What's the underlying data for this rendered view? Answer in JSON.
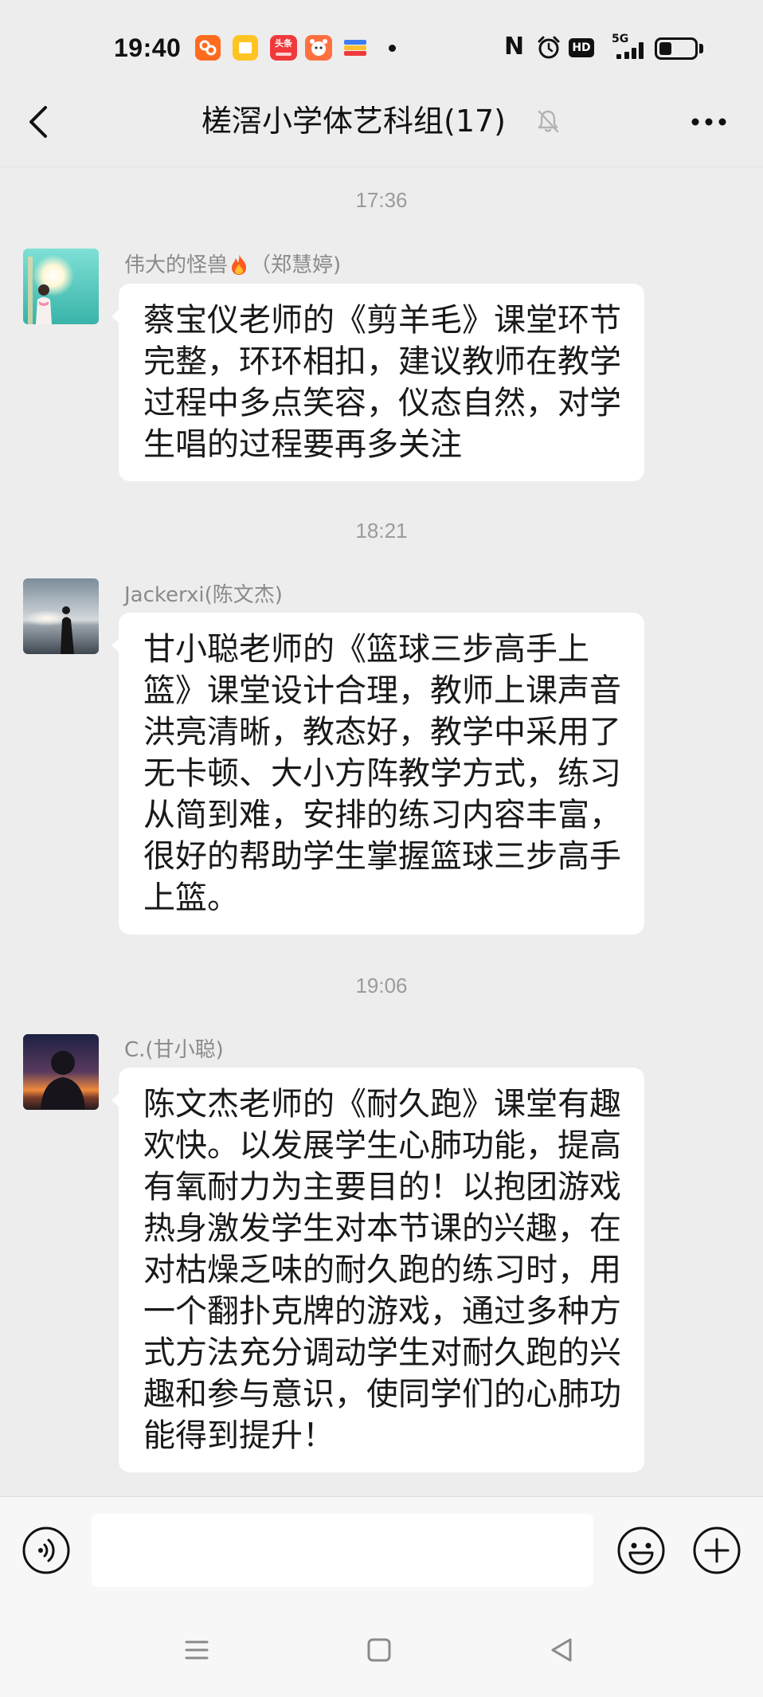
{
  "colors": {
    "background": "#ededed",
    "bubble": "#ffffff",
    "message_text": "#191919",
    "meta_text": "#9b9b9b",
    "bottom_bar": "#f7f7f7"
  },
  "status_bar": {
    "time": "19:40",
    "app_icons": [
      {
        "icon": "orange-app-icon",
        "color": "#ff6b1f"
      },
      {
        "icon": "notes-app-icon",
        "color": "#ffc423"
      },
      {
        "icon": "toutiao-app-icon",
        "color": "#f0393c",
        "label": "头条"
      },
      {
        "icon": "cartoon-app-icon",
        "color": "#ff7040"
      },
      {
        "icon": "stripes-app-icon",
        "color": "#3d7cf2"
      }
    ],
    "overflow_indicator": "dot-icon",
    "nfc_label": "N",
    "alarm_icon": "alarm-icon",
    "hd_label": "HD",
    "network_label": "5G",
    "signal_icon": "signal-bars-icon",
    "battery_icon": "battery-icon",
    "battery_level": 0.35
  },
  "header": {
    "back_icon": "back-arrow-icon",
    "title": "槎滘小学体艺科组(17)",
    "mute_icon": "bell-mute-icon",
    "more_icon": "more-dots-icon"
  },
  "messages": [
    {
      "time": "17:36",
      "avatar": "avatar-teal-photo",
      "sender": "伟大的怪兽",
      "sender_icon": "fire-icon",
      "sender_remark": "（郑慧婷)",
      "lines": [
        "蔡宝仪老师的《剪羊毛》课堂环节",
        "完整，环环相扣，建议教师在教学",
        "过程中多点笑容，仪态自然，对学",
        "生唱的过程要再多关注"
      ]
    },
    {
      "time": "18:21",
      "avatar": "avatar-seaside-photo",
      "sender": "Jackerxi(陈文杰)",
      "lines": [
        "甘小聪老师的《篮球三步高手上",
        "篮》课堂设计合理，教师上课声音",
        "洪亮清晰，教态好，教学中采用了",
        "无卡顿、大小方阵教学方式，练习",
        "从简到难，安排的练习内容丰富，",
        "很好的帮助学生掌握篮球三步高手",
        "上篮。"
      ]
    },
    {
      "time": "19:06",
      "avatar": "avatar-sunset-photo",
      "sender": "C.(甘小聪)",
      "lines": [
        "陈文杰老师的《耐久跑》课堂有趣",
        "欢快。以发展学生心肺功能，提高",
        "有氧耐力为主要目的！以抱团游戏",
        "热身激发学生对本节课的兴趣，在",
        "对枯燥乏味的耐久跑的练习时，用",
        "一个翻扑克牌的游戏，通过多种方",
        "式方法充分调动学生对耐久跑的兴",
        "趣和参与意识，使同学们的心肺功",
        "能得到提升！"
      ]
    }
  ],
  "input_bar": {
    "voice_icon": "voice-icon",
    "input_value": "",
    "emoji_icon": "emoji-icon",
    "plus_icon": "plus-icon"
  },
  "nav_bar": {
    "menu_icon": "menu-icon",
    "home_icon": "home-square-icon",
    "back_icon": "back-triangle-icon"
  }
}
